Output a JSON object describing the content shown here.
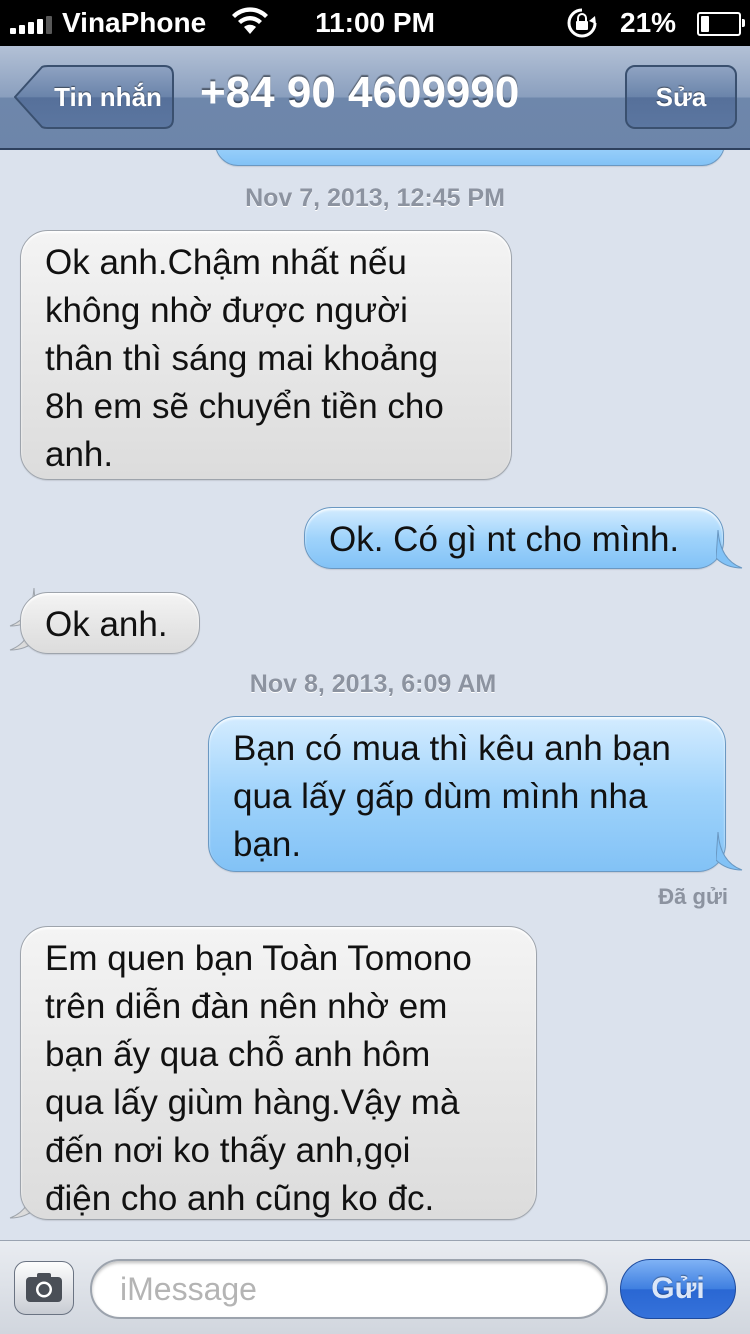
{
  "status_bar": {
    "carrier": "VinaPhone",
    "time": "11:00 PM",
    "battery_percent": "21%",
    "battery_level": 0.21,
    "icons": [
      "signal-icon",
      "wifi-icon",
      "rotation-lock-icon",
      "battery-icon"
    ]
  },
  "nav": {
    "back_label": "Tin nhắn",
    "title": "+84 90 4609990",
    "edit_label": "Sửa"
  },
  "conversation": {
    "timestamps": [
      "Nov 7, 2013, 12:45 PM",
      "Nov 8, 2013, 6:09 AM"
    ],
    "messages": [
      {
        "direction": "incoming",
        "lines": [
          "Ok anh.Chậm nhất nếu",
          "không nhờ được người",
          "thân thì sáng mai khoảng",
          "8h em sẽ chuyển tiền cho",
          "anh."
        ]
      },
      {
        "direction": "outgoing",
        "lines": [
          "Ok. Có gì nt cho mình."
        ]
      },
      {
        "direction": "incoming",
        "lines": [
          "Ok anh."
        ]
      },
      {
        "direction": "outgoing",
        "lines": [
          "Bạn có mua thì kêu anh bạn",
          "qua lấy gấp dùm mình nha",
          "bạn."
        ]
      },
      {
        "direction": "incoming",
        "lines": [
          "Em quen bạn Toàn Tomono",
          "trên diễn đàn nên nhờ em",
          "bạn ấy qua chỗ anh hôm",
          "qua lấy giùm hàng.Vậy mà",
          "đến nơi ko thấy anh,gọi",
          "điện cho anh cũng ko đc."
        ]
      }
    ],
    "delivered_label": "Đã gửi"
  },
  "input_bar": {
    "placeholder": "iMessage",
    "value": "",
    "send_label": "Gửi",
    "camera_icon": "camera-icon"
  },
  "colors": {
    "incoming_bubble": "#e6e6e6",
    "outgoing_bubble": "#9fd3fb",
    "background": "#dbe2ed",
    "nav_bar": "#6e87ab",
    "send_button": "#3572da"
  }
}
